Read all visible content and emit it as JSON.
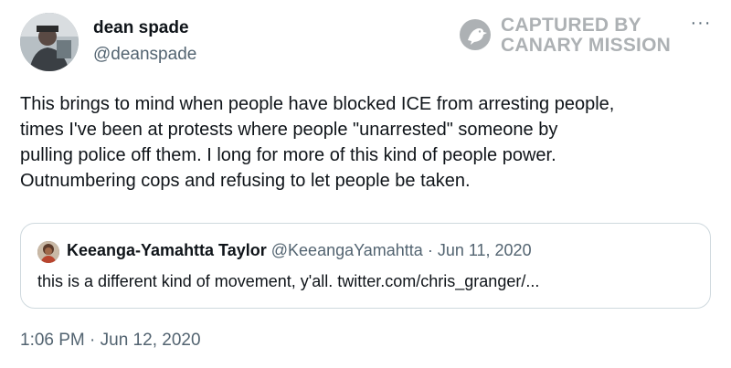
{
  "author": {
    "name": "dean spade",
    "handle": "@deanspade"
  },
  "watermark": {
    "line1": "CAPTURED BY",
    "line2": "CANARY MISSION",
    "icon": "canary-bird-icon"
  },
  "more_icon": "···",
  "tweet": {
    "lines": [
      "This brings to mind when people have blocked ICE from arresting people,",
      "times I've been at protests where people \"unarrested\" someone by",
      "pulling police off them. I long for more of this kind of people power.",
      "Outnumbering cops and refusing to let people be taken."
    ],
    "timestamp": "1:06 PM · Jun 12, 2020"
  },
  "quote": {
    "name": "Keeanga-Yamahtta Taylor",
    "handle": "@KeeangaYamahtta",
    "separator": " · ",
    "date": "Jun 11, 2020",
    "text": "this is a different kind of movement, y'all. twitter.com/chris_granger/..."
  }
}
